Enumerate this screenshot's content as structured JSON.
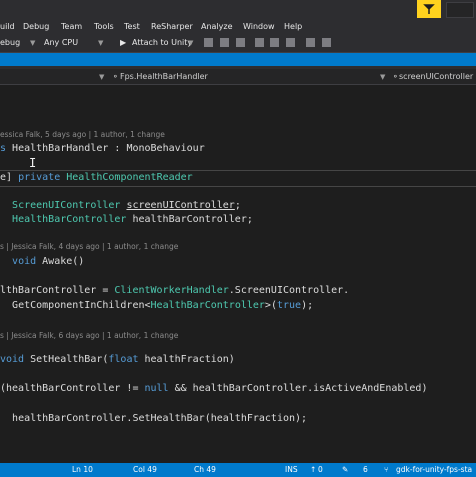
{
  "menu": {
    "items": [
      "uild",
      "Debug",
      "Team",
      "Tools",
      "Test",
      "ReSharper",
      "Analyze",
      "Window",
      "Help"
    ]
  },
  "toolbar": {
    "config": "ebug",
    "platform": "Any CPU",
    "attach": "Attach to Unity"
  },
  "navbar": {
    "class_path": "Fps.HealthBarHandler",
    "member": "screenUIController"
  },
  "code": {
    "lens1": "essica Falk, 5 days ago | 1 author, 1 change",
    "line1_kw": "s",
    "line1_rest": " HealthBarHandler : MonoBehaviour",
    "line2_a": "e]",
    "line2_kw": "private",
    "line2_ty": "HealthComponentReader",
    "line3_ty": "ScreenUIController",
    "line3_field": "screenUIController",
    "line3_end": ";",
    "line4_ty": "HealthBarController",
    "line4_rest": " healthBarController;",
    "lens2": "s | Jessica Falk, 4 days ago | 1 author, 1 change",
    "line5_kw": "void",
    "line5_rest": " Awake()",
    "line6_a": "lthBarController = ",
    "line6_ty": "ClientWorkerHandler",
    "line6_b": ".ScreenUIController.",
    "line7_a": "GetComponentInChildren<",
    "line7_ty": "HealthBarController",
    "line7_b": ">(",
    "line7_kw": "true",
    "line7_c": ");",
    "lens3": "s | Jessica Falk, 6 days ago | 1 author, 1 change",
    "line8_kw": "void",
    "line8_a": " SetHealthBar(",
    "line8_kw2": "float",
    "line8_b": " healthFraction)",
    "line9_a": "(healthBarController != ",
    "line9_kw": "null",
    "line9_b": " && healthBarController.isActiveAndEnabled)",
    "line10": "healthBarController.SetHealthBar(healthFraction);"
  },
  "status": {
    "ln": "Ln 10",
    "col": "Col 49",
    "ch": "Ch 49",
    "ins": "INS",
    "up_count": "0",
    "changes": "6",
    "branch": "gdk-for-unity-fps-sta"
  },
  "colors": {
    "accent": "#007acc",
    "keyword": "#569cd6",
    "type": "#4ec9b0",
    "pin": "#ffd21e"
  }
}
